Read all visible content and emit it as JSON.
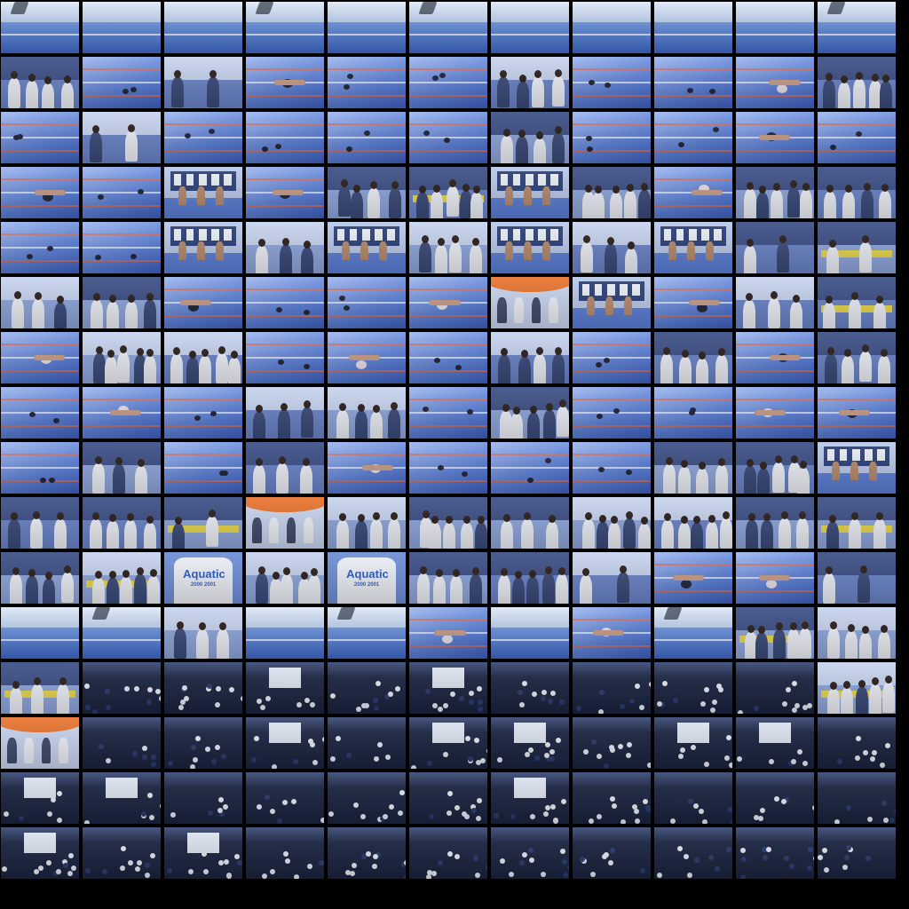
{
  "sheet": {
    "description_label": "Photo contact sheet",
    "columns": 11,
    "rows": 16,
    "background": "#000000"
  },
  "visible_text": {
    "aquatic_shirt_1": "Aquatic",
    "aquatic_shirt_2": "Aquatic",
    "aquatic_shirt_3": "Aquatic",
    "aquatic_shirt_4": "Aquatic",
    "aquatic_sub": "2000 2001"
  },
  "palette": {
    "pool_blue": "#5b7fd6",
    "pool_light": "#9fb8f0",
    "sky": "#cfe0f5",
    "dark_hall": "#1a2440",
    "yellow_board": "#e8d84a",
    "orange_umbrella": "#e8742f",
    "white_shirt": "#eef1f8"
  },
  "scene_codes": [
    "PPPPPPPPPPPC",
    "CWCSWWCWWSCC",
    "WCWWWWCWWSWC",
    "SWBSCCBCSCCC",
    "WWBCBCBCBCCS",
    "CCSWWSOBSCCO",
    "SCCWSWCWCSCC",
    "WSWCCWCWWSSS",
    "WCWCSWWWCCBA",
    "CCCOCCCCCCCS",
    "CCACACCCSSCC",
    "PPCPPSPSPCCC",
    "CHHHHHHHHHCC",
    "OHHHHHHHHHHH",
    "HHHHHHHHHHHH",
    "HHHHHHHHHHHH"
  ]
}
